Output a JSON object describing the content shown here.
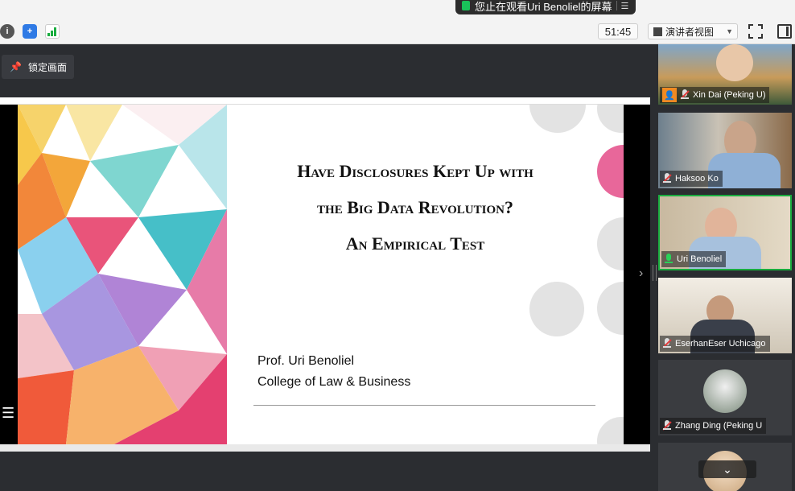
{
  "share_banner": {
    "text": "您止在观看Uri Benoliel的屏幕",
    "menu_icon": "list-icon"
  },
  "toolbar": {
    "info_icon": "info-icon",
    "shield_icon": "shield-icon",
    "signal_icon": "signal-bars-icon",
    "timer": "51:45",
    "view_label": "演讲者视图",
    "fullscreen_icon": "fullscreen-icon",
    "sidebar_icon": "sidebar-toggle-icon"
  },
  "lock_screen": {
    "label": "锁定画面",
    "icon": "pin-icon"
  },
  "slide": {
    "title_lines": [
      "Have Disclosures Kept Up with",
      "the Big Data Revolution?",
      "An Empirical Test"
    ],
    "author": "Prof. Uri Benoliel",
    "affiliation": "College of Law & Business"
  },
  "participants": [
    {
      "name": "Xin Dai (Peking U)",
      "mic": "muted",
      "host": true
    },
    {
      "name": "Haksoo Ko",
      "mic": "muted",
      "host": false
    },
    {
      "name": "Uri Benoliel",
      "mic": "live",
      "host": false,
      "active": true
    },
    {
      "name": "EserhanEser Uchicago",
      "mic": "muted",
      "host": false
    },
    {
      "name": "Zhang Ding (Peking U",
      "mic": "muted",
      "host": false
    }
  ],
  "colors": {
    "active_border": "#1aad3f",
    "muted_slash": "#e23b3b",
    "host_badge": "#f08a22",
    "accent_pink": "#e8679a"
  }
}
